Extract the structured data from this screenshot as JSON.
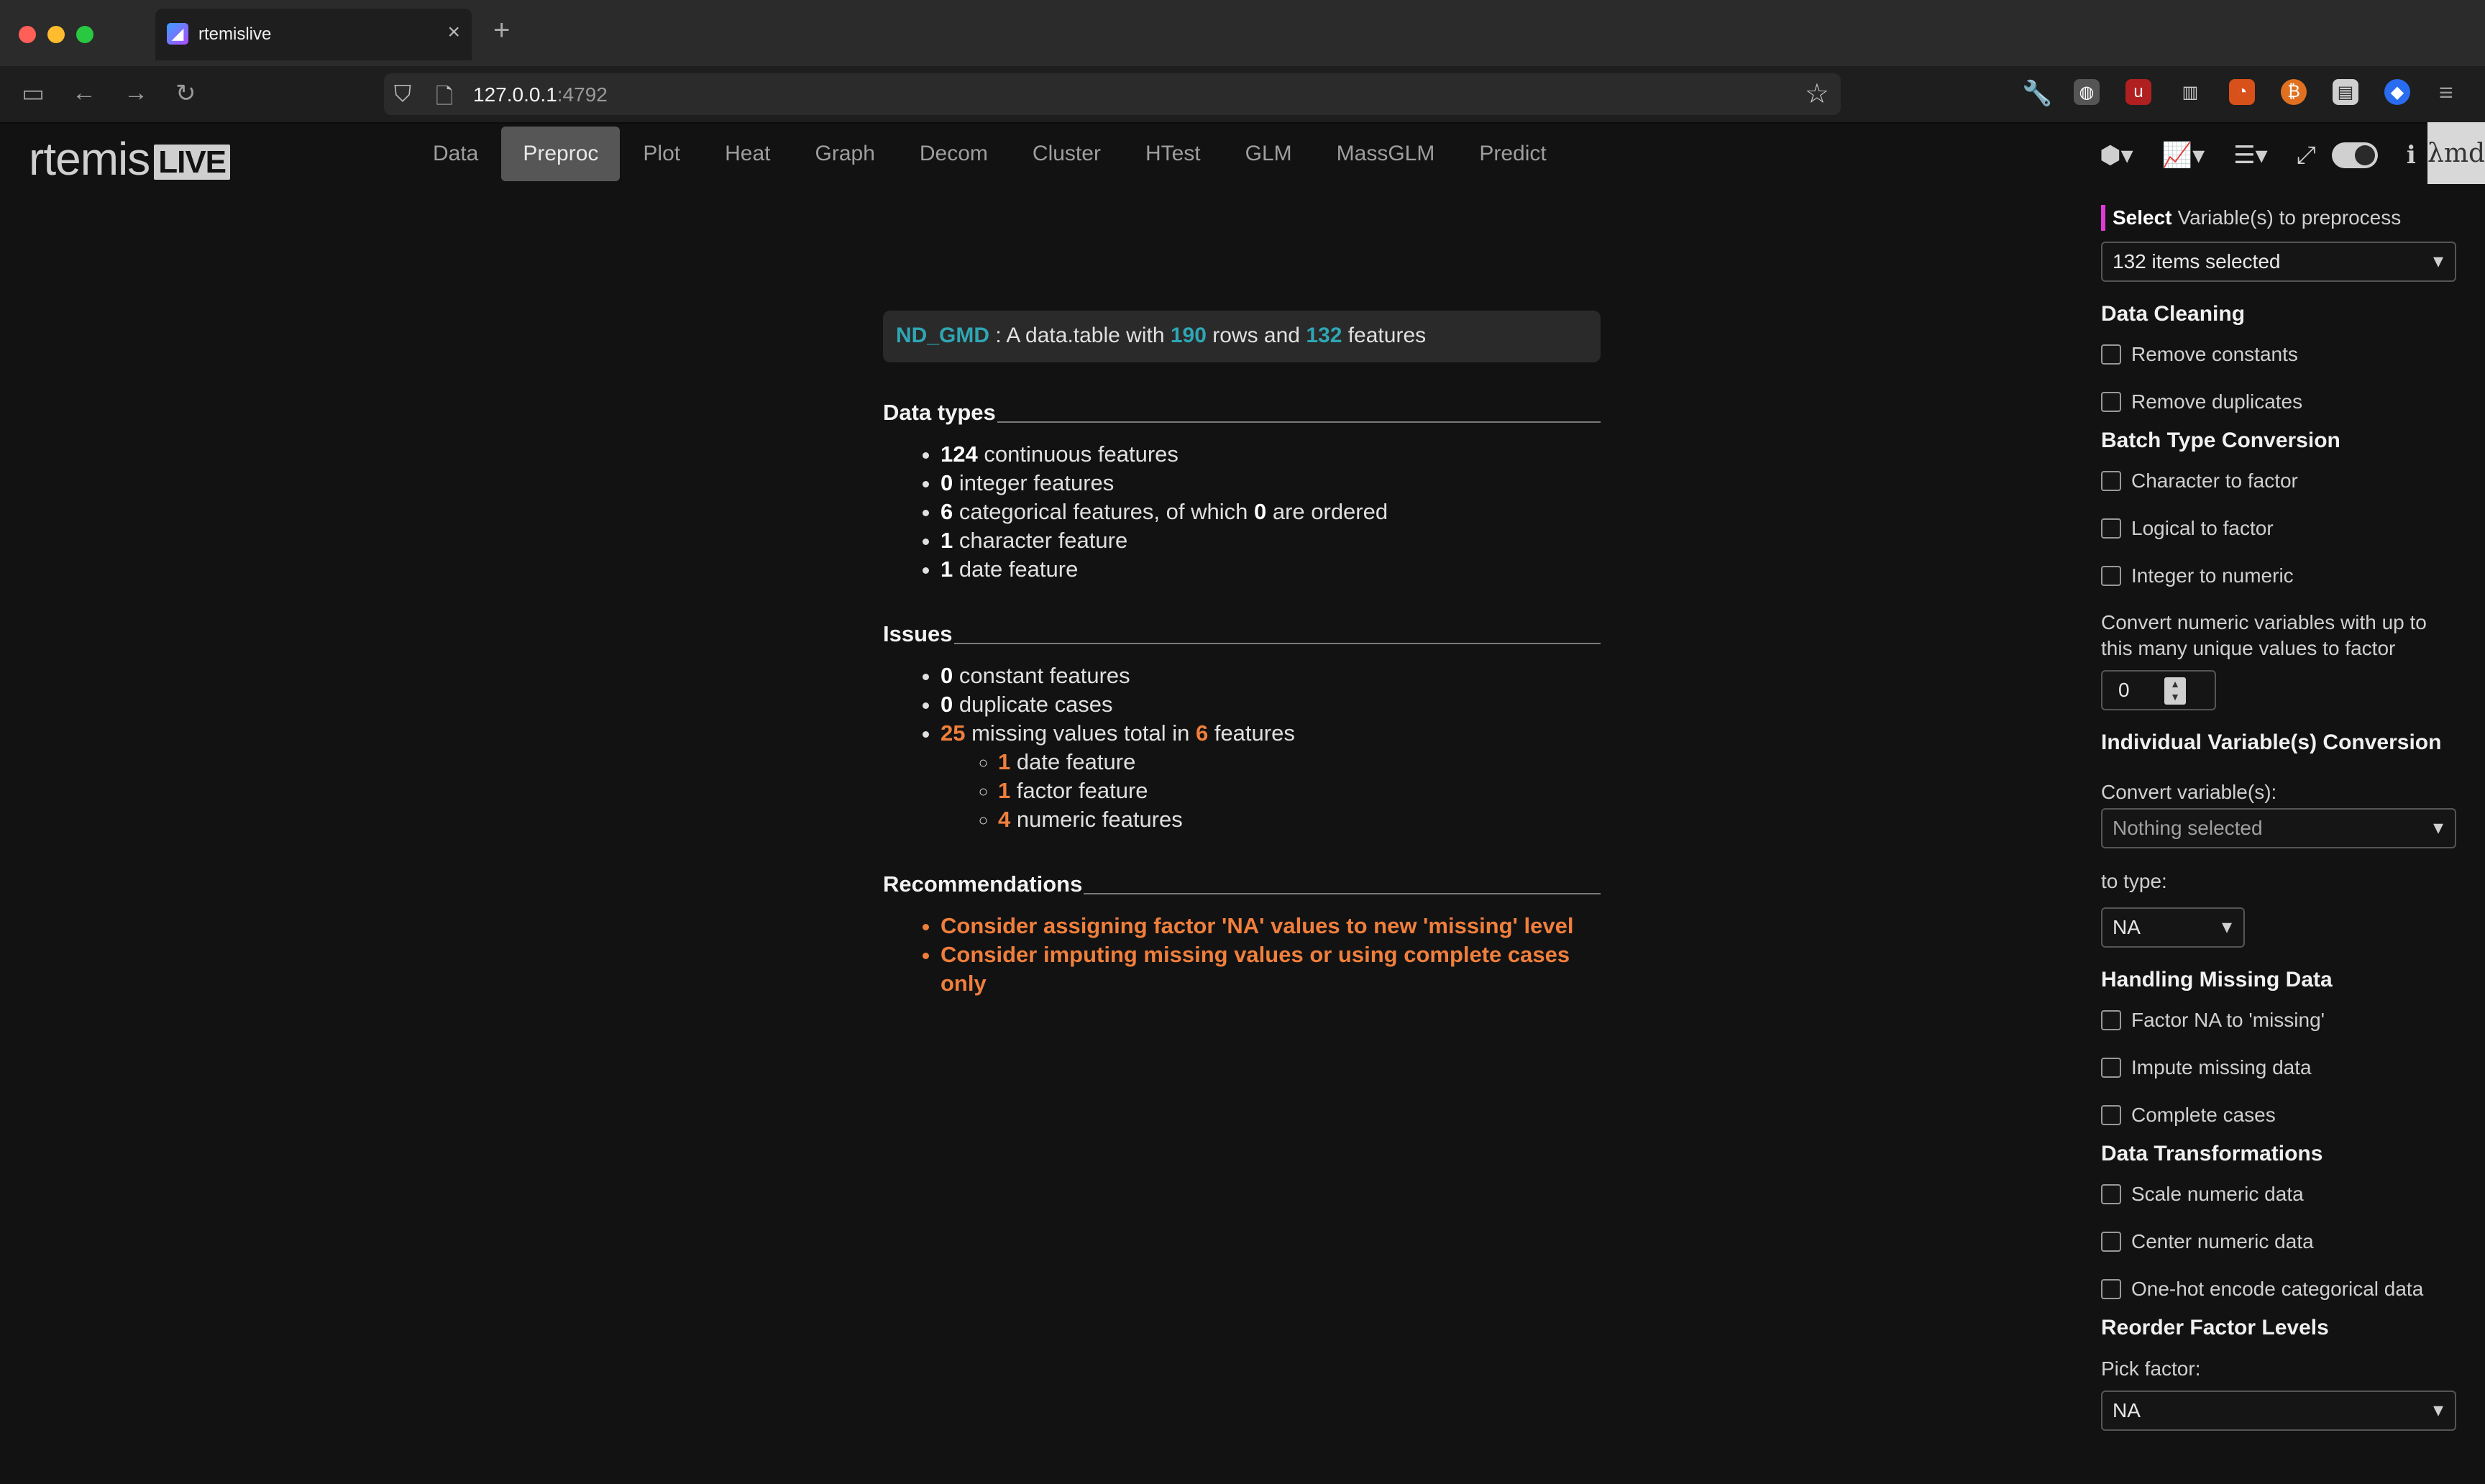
{
  "browser": {
    "tab_title": "rtemislive",
    "url_host": "127.0.0.1",
    "url_port": ":4792",
    "new_tab": "+",
    "close": "×"
  },
  "app": {
    "logo_text": "rtemis",
    "logo_badge": "LIVE",
    "nav": [
      "Data",
      "Preproc",
      "Plot",
      "Heat",
      "Graph",
      "Decom",
      "Cluster",
      "HTest",
      "GLM",
      "MassGLM",
      "Predict"
    ],
    "active_nav": "Preproc",
    "corner_logo": "λmd"
  },
  "summary": {
    "name": "ND_GMD",
    "text1": " : A data.table with ",
    "rows": "190",
    "text2": " rows and ",
    "features": "132",
    "text3": " features"
  },
  "data_types": {
    "heading": "Data types",
    "items": [
      {
        "n": "124",
        "t": " continuous features"
      },
      {
        "n": "0",
        "t": " integer features"
      },
      {
        "n": "6",
        "t": " categorical features, of which ",
        "n2": "0",
        "t2": " are ordered"
      },
      {
        "n": "1",
        "t": " character feature"
      },
      {
        "n": "1",
        "t": " date feature"
      }
    ]
  },
  "issues": {
    "heading": "Issues",
    "items": [
      {
        "n": "0",
        "t": " constant features"
      },
      {
        "n": "0",
        "t": " duplicate cases"
      },
      {
        "n": "25",
        "t": " missing values total in ",
        "n2": "6",
        "t2": " features"
      }
    ],
    "sub": [
      {
        "n": "1",
        "t": " date feature"
      },
      {
        "n": "1",
        "t": " factor feature"
      },
      {
        "n": "4",
        "t": " numeric features"
      }
    ]
  },
  "recommendations": {
    "heading": "Recommendations",
    "items": [
      "Consider assigning factor 'NA' values to new 'missing' level",
      "Consider imputing missing values or using complete cases only"
    ]
  },
  "panel": {
    "select_bold": "Select",
    "select_rest": "Variable(s) to preprocess",
    "select_value": "132 items selected",
    "data_cleaning": "Data Cleaning",
    "remove_constants": "Remove constants",
    "remove_duplicates": "Remove duplicates",
    "batch_type": "Batch Type Conversion",
    "char_to_factor": "Character to factor",
    "logical_to_factor": "Logical to factor",
    "integer_to_numeric": "Integer to numeric",
    "convert_note": "Convert numeric variables with up to this many unique values to factor",
    "convert_value": "0",
    "individual_conv": "Individual Variable(s) Conversion",
    "convert_vars_label": "Convert variable(s):",
    "convert_vars_value": "Nothing selected",
    "to_type_label": "to type:",
    "to_type_value": "NA",
    "missing_data": "Handling Missing Data",
    "factor_na": "Factor NA to 'missing'",
    "impute": "Impute missing data",
    "complete_cases": "Complete cases",
    "transformations": "Data Transformations",
    "scale": "Scale numeric data",
    "center": "Center numeric data",
    "onehot": "One-hot encode categorical data",
    "reorder": "Reorder Factor Levels",
    "pick_factor_label": "Pick factor:",
    "pick_factor_value": "NA"
  },
  "colors": {
    "accent_teal": "#2fa6b3",
    "warning_orange": "#f07f3c",
    "select_accent": "#e03ad6"
  },
  "icons": [
    "sidebar-icon",
    "back-icon",
    "forward-icon",
    "reload-icon",
    "shield-icon",
    "page-icon",
    "star-icon",
    "wrench-icon",
    "menu-icon",
    "cube-icon",
    "chart-icon",
    "list-icon",
    "expand-icon",
    "info-icon"
  ]
}
